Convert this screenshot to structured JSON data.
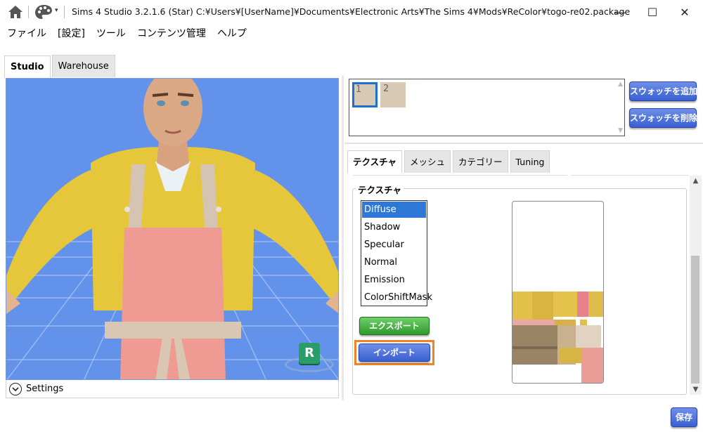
{
  "window": {
    "title": "Sims 4 Studio 3.2.1.6 (Star)  C:¥Users¥[UserName]¥Documents¥Electronic Arts¥The Sims 4¥Mods¥ReColor¥togo-re02.package",
    "minimize": "—",
    "maximize": "☐",
    "close": "✕"
  },
  "menu": {
    "items": [
      "ファイル",
      "[設定]",
      "ツール",
      "コンテンツ管理",
      "ヘルプ"
    ]
  },
  "left_tabs": [
    "Studio",
    "Warehouse"
  ],
  "viewport": {
    "badge": "R",
    "settings_label": "Settings"
  },
  "swatches": {
    "items": [
      {
        "label": "1",
        "color": "#d8cab5",
        "selected": true
      },
      {
        "label": "2",
        "color": "#d8cab5",
        "selected": false
      }
    ],
    "add_button": "スウォッチを追加",
    "delete_button": "スウォッチを削除"
  },
  "right_tabs": [
    "テクスチャ",
    "メッシュ",
    "カテゴリー",
    "Tuning"
  ],
  "texture_panel": {
    "group_title": "テクスチャ",
    "texture_types": [
      "Diffuse",
      "Shadow",
      "Specular",
      "Normal",
      "Emission",
      "ColorShiftMask"
    ],
    "selected_type": "Diffuse",
    "export_button": "エクスポート",
    "import_button": "インポート"
  },
  "footer": {
    "save_button": "保存"
  },
  "colors": {
    "viewport_bg": "#6292ea",
    "select_blue": "#2d78d6",
    "highlight_orange": "#f08228",
    "export_green": "#2f9a2d"
  }
}
